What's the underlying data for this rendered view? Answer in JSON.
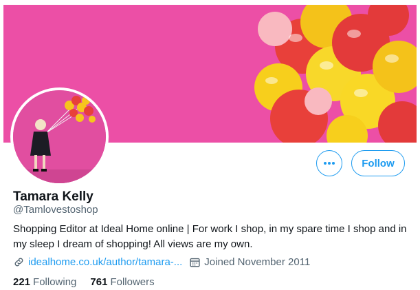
{
  "profile": {
    "name": "Tamara Kelly",
    "handle": "@Tamlovestoshop",
    "bio": "Shopping Editor at Ideal Home online | For work I shop, in my spare time I shop and in my sleep I dream of shopping! All views are my own.",
    "website": "idealhome.co.uk/author/tamara-...",
    "joined": "Joined November 2011",
    "following_count": "221",
    "following_label": "Following",
    "followers_count": "761",
    "followers_label": "Followers"
  },
  "actions": {
    "follow_label": "Follow",
    "more_icon": "more-horizontal-icon"
  },
  "colors": {
    "accent": "#1d9bf0",
    "banner_pink": "#ec4fa6",
    "balloon_red": "#e23b3b",
    "balloon_yellow": "#f6d21b"
  }
}
